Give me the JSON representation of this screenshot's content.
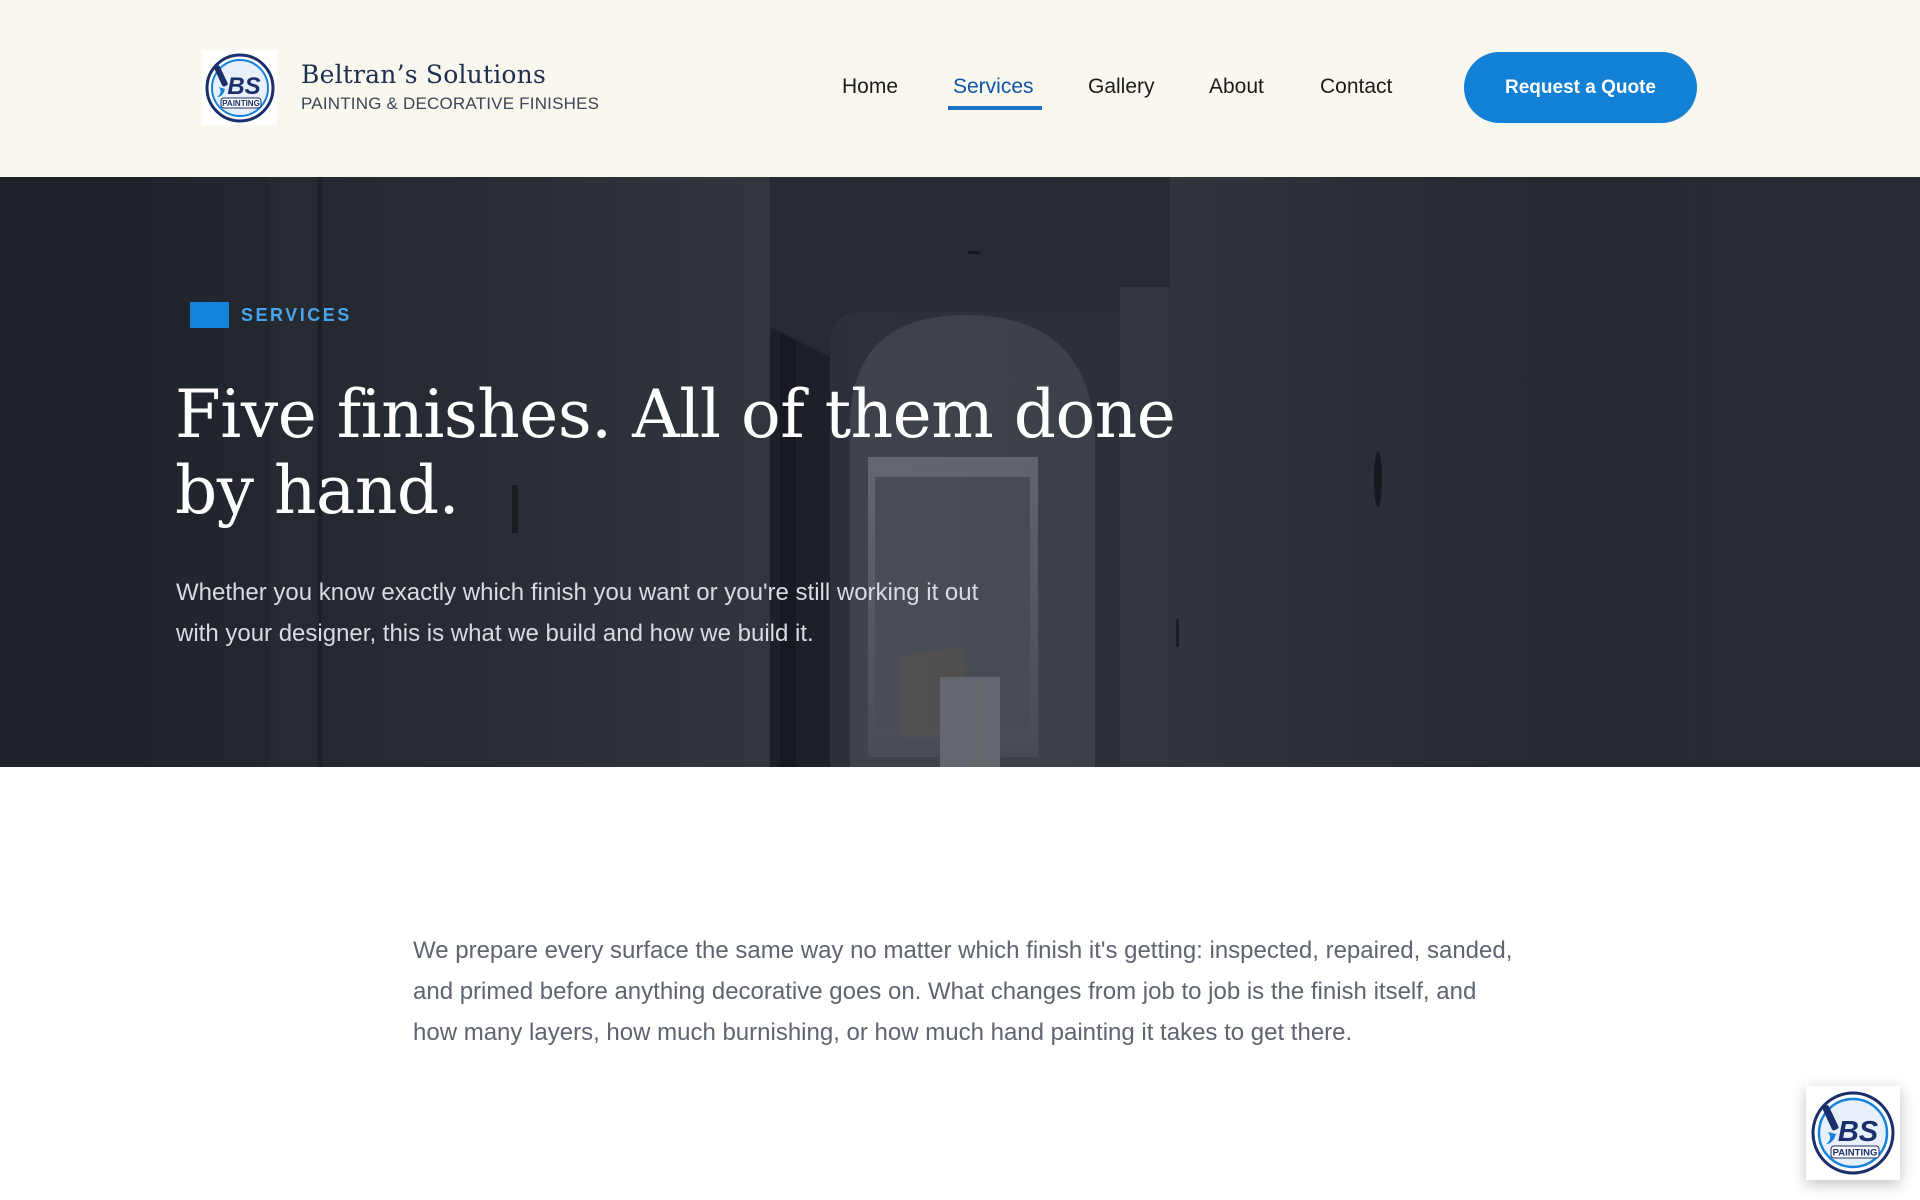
{
  "header": {
    "logo_initials": "BS",
    "logo_label": "PAINTING",
    "brand_name": "Beltran’s Solutions",
    "brand_tagline": "PAINTING & DECORATIVE FINISHES",
    "nav": [
      {
        "label": "Home",
        "active": false
      },
      {
        "label": "Services",
        "active": true
      },
      {
        "label": "Gallery",
        "active": false
      },
      {
        "label": "About",
        "active": false
      },
      {
        "label": "Contact",
        "active": false
      }
    ],
    "cta_label": "Request a Quote"
  },
  "hero": {
    "eyebrow": "SERVICES",
    "title": "Five finishes. All of them done by hand.",
    "subtitle": "Whether you know exactly which finish you want or you're still working it out with your designer, this is what we build and how we build it."
  },
  "intro": {
    "text": "We prepare every surface the same way no matter which finish it's getting: inspected, repaired, sanded, and primed before anything decorative goes on. What changes from job to job is the finish itself, and how many layers, how much burnishing, or how much hand painting it takes to get there."
  },
  "floating_badge": {
    "initials": "BS",
    "label": "PAINTING"
  },
  "colors": {
    "header_bg": "#f9f7ee",
    "accent": "#1280d4",
    "nav_active": "#0d56a6",
    "eyebrow": "#4aa4ec",
    "logo_navy": "#1d2f6b"
  },
  "icons": {
    "logo": "bs-painting-logo-icon",
    "badge": "bs-painting-badge-icon"
  }
}
